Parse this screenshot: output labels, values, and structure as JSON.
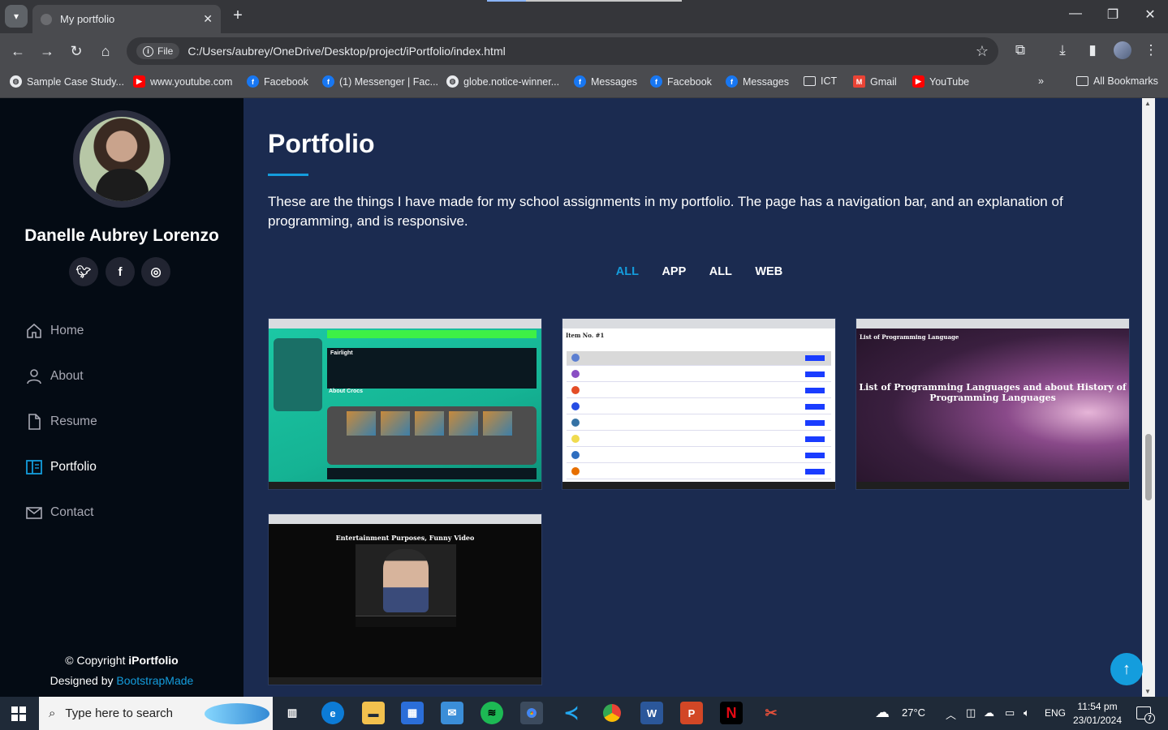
{
  "browser": {
    "tab_title": "My portfolio",
    "url_chip": "File",
    "url": "C:/Users/aubrey/OneDrive/Desktop/project/iPortfolio/index.html",
    "bookmarks": [
      {
        "label": "Sample Case Study...",
        "icon": "globe"
      },
      {
        "label": "www.youtube.com",
        "icon": "youtube"
      },
      {
        "label": "Facebook",
        "icon": "facebook"
      },
      {
        "label": "(1) Messenger | Fac...",
        "icon": "facebook"
      },
      {
        "label": "globe.notice-winner...",
        "icon": "globe"
      },
      {
        "label": "Messages",
        "icon": "facebook"
      },
      {
        "label": "Facebook",
        "icon": "facebook"
      },
      {
        "label": "Messages",
        "icon": "facebook"
      },
      {
        "label": "ICT",
        "icon": "folder"
      },
      {
        "label": "Gmail",
        "icon": "gmail"
      },
      {
        "label": "YouTube",
        "icon": "youtube"
      }
    ],
    "all_bookmarks": "All Bookmarks",
    "more_chevron": "»"
  },
  "sidebar": {
    "name": "Danelle Aubrey Lorenzo",
    "social": [
      "twitter",
      "facebook",
      "instagram"
    ],
    "menu": [
      {
        "label": "Home",
        "icon": "home-icon",
        "active": false
      },
      {
        "label": "About",
        "icon": "person-icon",
        "active": false
      },
      {
        "label": "Resume",
        "icon": "file-icon",
        "active": false
      },
      {
        "label": "Portfolio",
        "icon": "book-icon",
        "active": true
      },
      {
        "label": "Contact",
        "icon": "envelope-icon",
        "active": false
      }
    ],
    "copyright_prefix": "© Copyright ",
    "copyright_brand": "iPortfolio",
    "designed_by": "Designed by ",
    "designed_link": "BootstrapMade"
  },
  "portfolio": {
    "title": "Portfolio",
    "description": "These are the things I have made for my school assignments in my portfolio. The page has a navigation bar, and an explanation of programming, and is responsive.",
    "filters": [
      "ALL",
      "APP",
      "ALL",
      "WEB"
    ],
    "active_filter": 0,
    "thumbnails": {
      "t1_heading": "Fairlight",
      "t1_section": "About Crocs",
      "t2_heading": "Item No. #1",
      "t3_small": "List of Programming Language",
      "t3_heading": "List of Programming Languages and about History of Programming Languages",
      "t4_heading": "Entertainment Purposes, Funny Video"
    }
  },
  "colors": {
    "accent": "#149ddd",
    "sidebar_bg": "#040b14",
    "main_bg": "#1b2b50"
  },
  "taskbar": {
    "search_placeholder": "Type here to search",
    "weather": "27°C",
    "language": "ENG",
    "time": "11:54 pm",
    "date": "23/01/2024",
    "notification_count": "7"
  }
}
